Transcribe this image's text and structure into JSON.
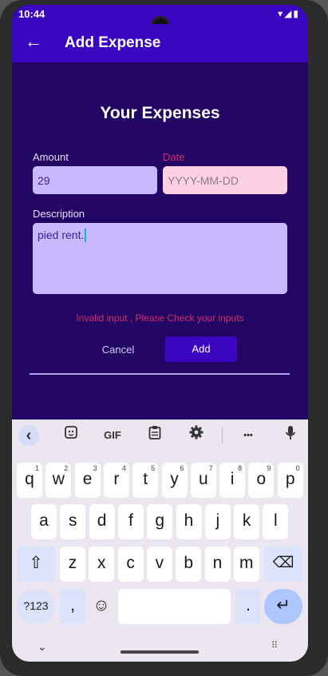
{
  "status": {
    "time": "10:44",
    "icons": "▾◢▮"
  },
  "appbar": {
    "back_icon": "←",
    "title": "Add Expense"
  },
  "form": {
    "heading": "Your Expenses",
    "amount_label": "Amount",
    "amount_value": "29",
    "date_label": "Date",
    "date_placeholder": "YYYY-MM-DD",
    "description_label": "Description",
    "description_value": "pied rent.",
    "error": "Invalid input , Please Check your inputs",
    "cancel_label": "Cancel",
    "add_label": "Add"
  },
  "keyboard": {
    "toolbar": {
      "collapse": "‹",
      "gif": "GIF",
      "more": "•••"
    },
    "row1": [
      "q",
      "w",
      "e",
      "r",
      "t",
      "y",
      "u",
      "i",
      "o",
      "p"
    ],
    "row1_hints": [
      "1",
      "2",
      "3",
      "4",
      "5",
      "6",
      "7",
      "8",
      "9",
      "0"
    ],
    "row2": [
      "a",
      "s",
      "d",
      "f",
      "g",
      "h",
      "j",
      "k",
      "l"
    ],
    "row3": [
      "z",
      "x",
      "c",
      "v",
      "b",
      "n",
      "m"
    ],
    "symbols_key": "?123",
    "comma_key": ",",
    "period_key": ".",
    "enter_icon": "↵",
    "shift_icon": "⇧",
    "backspace_icon": "⌫",
    "emoji_icon": "☺",
    "hide_icon": "⌄",
    "grid_icon": "⠿"
  }
}
